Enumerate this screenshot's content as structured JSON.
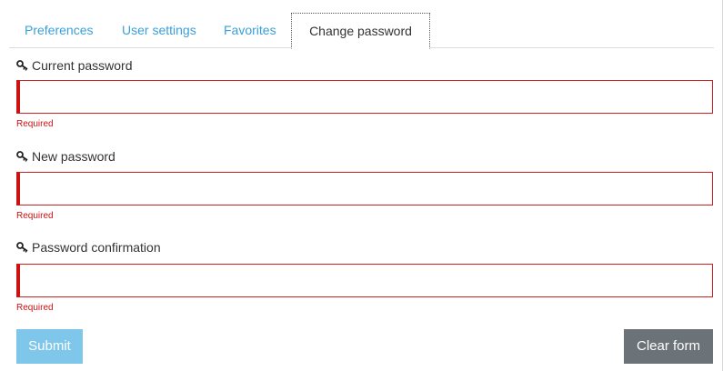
{
  "tabs": [
    {
      "label": "Preferences",
      "active": false
    },
    {
      "label": "User settings",
      "active": false
    },
    {
      "label": "Favorites",
      "active": false
    },
    {
      "label": "Change password",
      "active": true
    }
  ],
  "form": {
    "fields": [
      {
        "icon": "key-icon",
        "label": "Current password",
        "value": "",
        "error": "Required"
      },
      {
        "icon": "key-icon",
        "label": "New password",
        "value": "",
        "error": "Required"
      },
      {
        "icon": "key-icon",
        "label": "Password confirmation",
        "value": "",
        "error": "Required"
      }
    ],
    "submit_label": "Submit",
    "clear_label": "Clear form"
  },
  "colors": {
    "tab_link": "#3a9fd8",
    "error": "#cc1111",
    "submit_bg": "#7ec6ea",
    "clear_bg": "#6c7378"
  }
}
